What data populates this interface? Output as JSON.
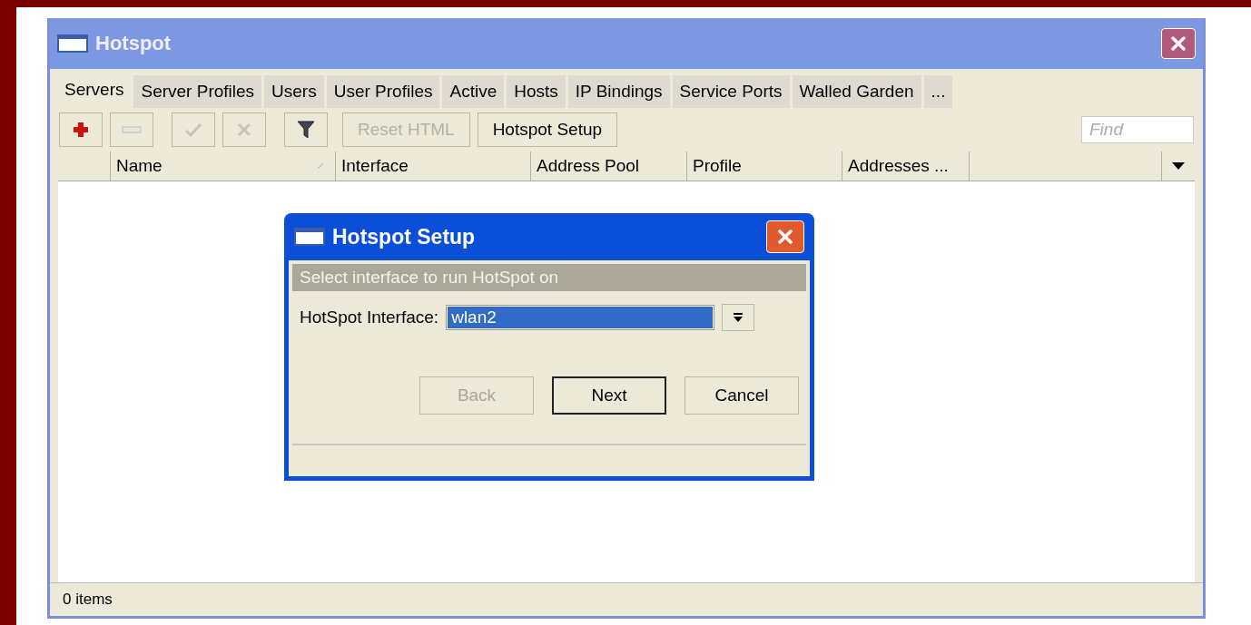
{
  "window": {
    "title": "Hotspot"
  },
  "tabs": [
    {
      "label": "Servers",
      "selected": true
    },
    {
      "label": "Server Profiles",
      "selected": false
    },
    {
      "label": "Users",
      "selected": false
    },
    {
      "label": "User Profiles",
      "selected": false
    },
    {
      "label": "Active",
      "selected": false
    },
    {
      "label": "Hosts",
      "selected": false
    },
    {
      "label": "IP Bindings",
      "selected": false
    },
    {
      "label": "Service Ports",
      "selected": false
    },
    {
      "label": "Walled Garden",
      "selected": false
    },
    {
      "label": "...",
      "selected": false
    }
  ],
  "toolbar": {
    "buttons": [
      {
        "kind": "add",
        "disabled": false
      },
      {
        "kind": "remove",
        "disabled": true
      },
      {
        "kind": "enable",
        "disabled": true
      },
      {
        "kind": "disable",
        "disabled": true
      },
      {
        "kind": "filter",
        "disabled": false
      },
      {
        "kind": "text",
        "label": "Reset HTML",
        "disabled": true
      },
      {
        "kind": "text",
        "label": "Hotspot Setup",
        "disabled": false
      }
    ],
    "search": {
      "placeholder": "Find"
    }
  },
  "table": {
    "columns": [
      {
        "label": "Name",
        "sorted": true
      },
      {
        "label": "Interface",
        "sorted": false
      },
      {
        "label": "Address Pool",
        "sorted": false
      },
      {
        "label": "Profile",
        "sorted": false
      },
      {
        "label": "Addresses ...",
        "sorted": false
      }
    ]
  },
  "status_bar": "0 items",
  "dialog": {
    "title": "Hotspot Setup",
    "instruction": "Select interface to run HotSpot on",
    "field": {
      "label": "HotSpot Interface:",
      "value": "wlan2"
    },
    "buttons": [
      {
        "label": "Back",
        "disabled": true,
        "default": false
      },
      {
        "label": "Next",
        "disabled": false,
        "default": true
      },
      {
        "label": "Cancel",
        "disabled": false,
        "default": false
      }
    ]
  }
}
